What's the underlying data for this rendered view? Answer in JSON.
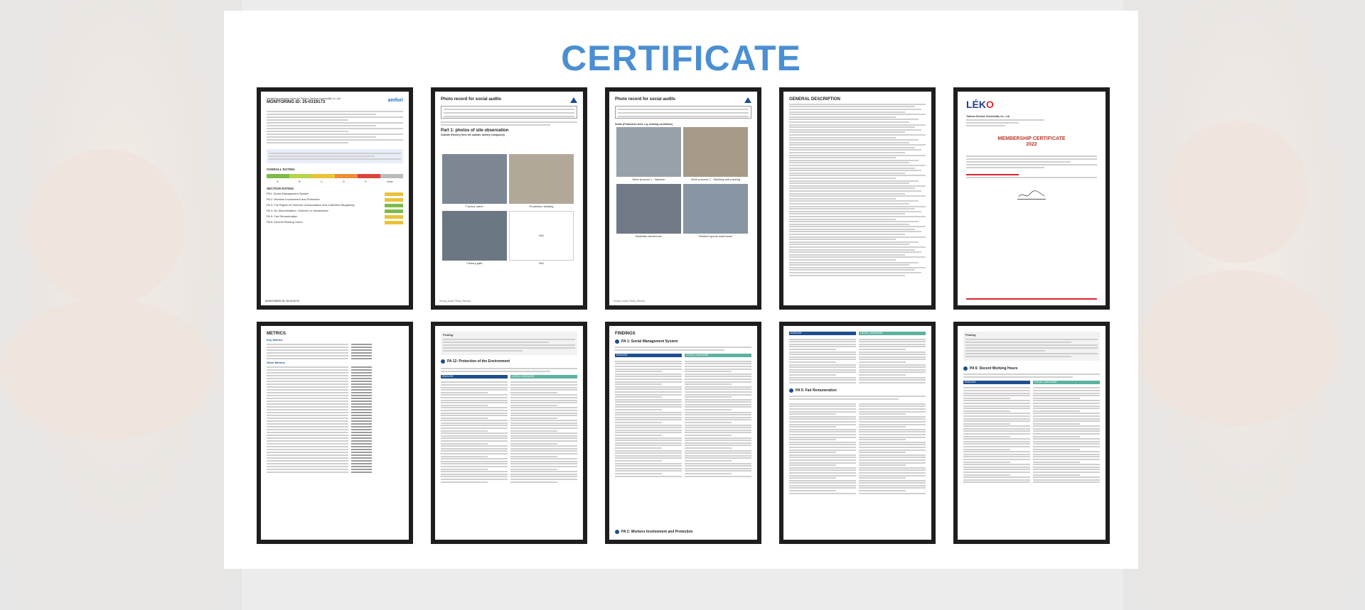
{
  "page": {
    "title": "CERTIFICATE"
  },
  "documents": [
    {
      "id": "monitoring-summary",
      "header": "Monitoring summary report for Taizhou Sondus Commodity Co.,Ltd",
      "heading": "MONITORING ID: 25-0319173",
      "logo": "amfori",
      "overall_rating_label": "OVERALL RATING",
      "section_rating_label": "SECTION RATING",
      "rating_scale": [
        "A",
        "B",
        "C",
        "D",
        "E",
        "None"
      ],
      "sections": [
        "PA1: Social Management System",
        "PA 2: Workers Involvement and Protection",
        "PA 3: The Rights of Freedom of Association and Collective Bargaining",
        "PA 4: No Discrimination, Violence or Harassment",
        "PA 5: Fair Remuneration",
        "PA 6: Decent Working Hours"
      ],
      "footer": "MONITORING ID: 25-0319173"
    },
    {
      "id": "photo-record-1",
      "heading": "Photo record for social audits",
      "part": "Part 1: photos of site observation",
      "subheading": "Outside (Factory from the outside, factory compound)",
      "captions": [
        "Factory name",
        "Production building",
        "N/A",
        "Factory gate",
        "N/A"
      ],
      "footer": "Social_Audit_Photo_Record"
    },
    {
      "id": "photo-record-2",
      "heading": "Photo record for social audits",
      "subheading": "Inside (Production area, e.g. working conditions)",
      "captions": [
        "Work process 1 - Injection",
        "Work process 2 - Stacking and packing",
        "Materials warehouse",
        "Finished goods warehouse"
      ],
      "footer": "Social_Audit_Photo_Record"
    },
    {
      "id": "general-description",
      "heading": "GENERAL DESCRIPTION"
    },
    {
      "id": "membership-certificate",
      "logo_text_a": "LÉK",
      "logo_text_b": "O",
      "company": "Taizhou Sondus Commodity Co., Ltd",
      "title": "MEMBERSHIP CERTIFICATE",
      "year": "2022"
    },
    {
      "id": "metrics",
      "heading": "METRICS",
      "subheads": [
        "Key Metrics",
        "Other Metrics"
      ]
    },
    {
      "id": "findings-pa2",
      "finding_label": "Finding",
      "section": "PA 12: Protection of the Environment",
      "lang_a": "ENGLISH",
      "lang_b": "LOCAL LANGUAGE"
    },
    {
      "id": "findings",
      "heading": "FINDINGS",
      "section_1": "PA 1: Social Management System",
      "section_2": "PA 2: Workers Involvement and Protection",
      "lang_a": "ENGLISH",
      "lang_b": "LOCAL LANGUAGE"
    },
    {
      "id": "findings-pa5",
      "section": "PA 5: Fair Remuneration",
      "lang_a": "ENGLISH",
      "lang_b": "LOCAL LANGUAGE"
    },
    {
      "id": "findings-pa6",
      "finding_label": "Finding",
      "section": "PA 6: Decent Working Hours",
      "lang_a": "ENGLISH",
      "lang_b": "LOCAL LANGUAGE"
    }
  ],
  "colors": {
    "title": "#4b8fd2",
    "frame": "#1e1e1e",
    "accent_blue": "#1d4f91",
    "accent_teal": "#5cb2a0",
    "rating_yellow": "#e9c23a",
    "rating_green": "#7dbb4a"
  }
}
